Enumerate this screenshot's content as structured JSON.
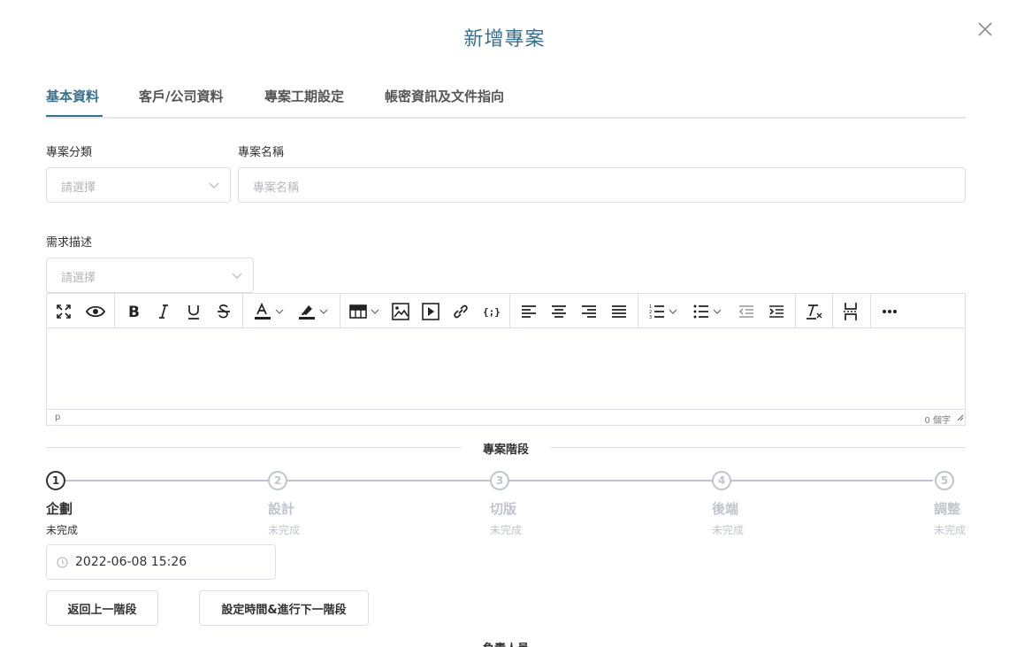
{
  "dialog": {
    "title": "新增專案"
  },
  "tabs": [
    {
      "label": "基本資料",
      "active": true
    },
    {
      "label": "客戶/公司資料",
      "active": false
    },
    {
      "label": "專案工期設定",
      "active": false
    },
    {
      "label": "帳密資訊及文件指向",
      "active": false
    }
  ],
  "form": {
    "category": {
      "label": "專案分類",
      "placeholder": "請選擇"
    },
    "name": {
      "label": "專案名稱",
      "placeholder": "專案名稱"
    },
    "description": {
      "label": "需求描述",
      "placeholder": "請選擇"
    }
  },
  "editor": {
    "status_path": "p",
    "word_count": "0 個字"
  },
  "stages": {
    "heading": "專案階段",
    "steps": [
      {
        "number": "1",
        "title": "企劃",
        "status": "未完成",
        "active": true
      },
      {
        "number": "2",
        "title": "設計",
        "status": "未完成",
        "active": false
      },
      {
        "number": "3",
        "title": "切版",
        "status": "未完成",
        "active": false
      },
      {
        "number": "4",
        "title": "後端",
        "status": "未完成",
        "active": false
      },
      {
        "number": "5",
        "title": "調整",
        "status": "未完成",
        "active": false
      }
    ],
    "datetime": "2022-06-08 15:26",
    "back_button": "返回上一階段",
    "next_button": "設定時間&進行下一階段"
  },
  "next_section": {
    "label": "負責人員"
  },
  "colors": {
    "accent": "#3b6f8c",
    "border": "#dcdfe6",
    "muted": "#c0c4cc"
  }
}
